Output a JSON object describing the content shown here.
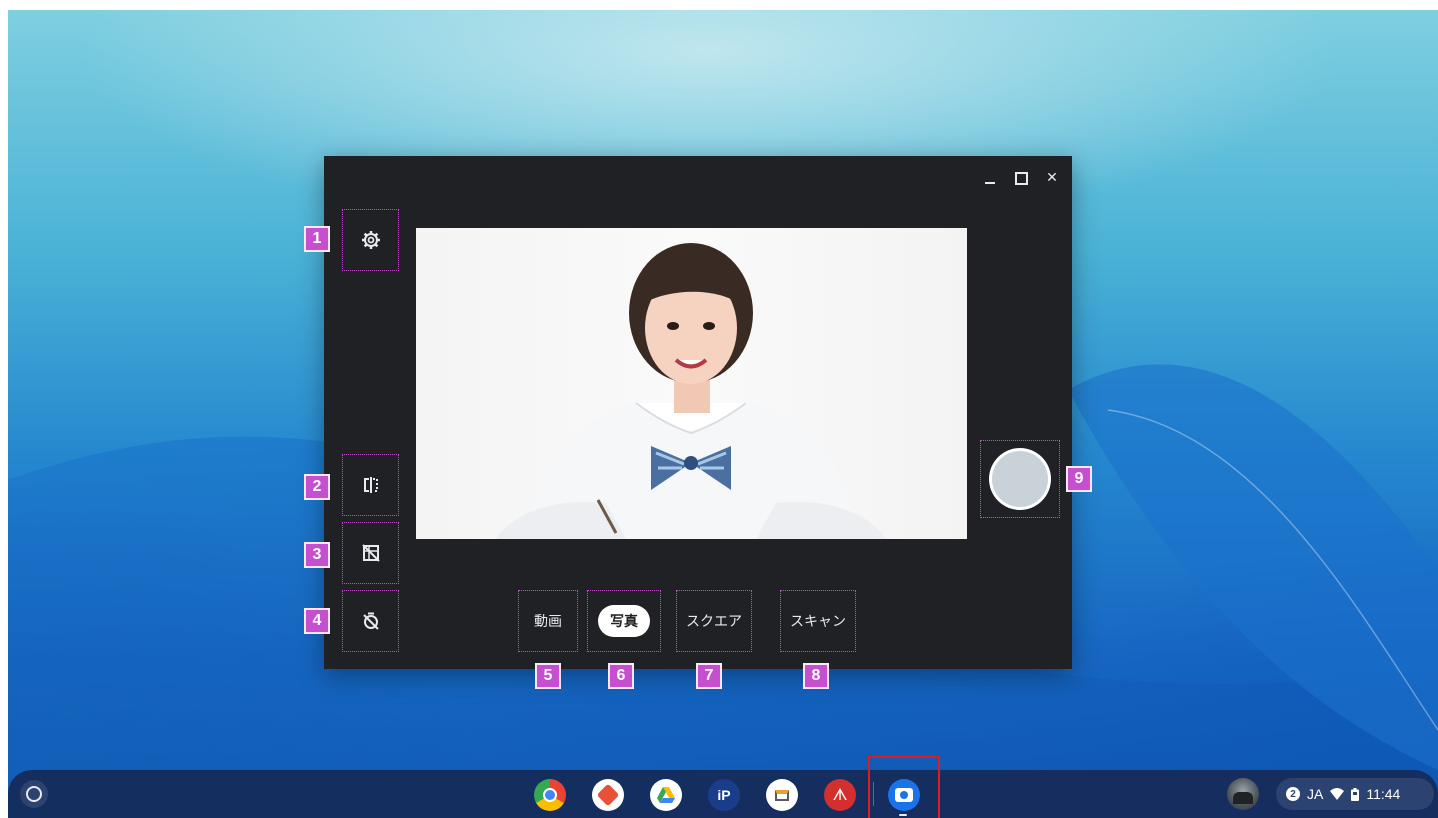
{
  "window": {
    "controls": {
      "minimize": "minimize-icon",
      "maximize": "maximize-icon",
      "close": "close-icon"
    }
  },
  "sidebar": {
    "settings": {
      "icon": "gear-icon",
      "number": "1"
    },
    "mirror": {
      "icon": "mirror-icon",
      "number": "2"
    },
    "grid": {
      "icon": "grid-off-icon",
      "number": "3"
    },
    "timer": {
      "icon": "timer-off-icon",
      "number": "4"
    }
  },
  "modes": [
    {
      "label": "動画",
      "number": "5"
    },
    {
      "label": "写真",
      "number": "6",
      "selected": true
    },
    {
      "label": "スクエア",
      "number": "7"
    },
    {
      "label": "スキャン",
      "number": "8"
    }
  ],
  "shutter": {
    "number": "9"
  },
  "shelf": {
    "apps": [
      "chrome-icon",
      "app-icon",
      "google-drive-icon",
      "picsart-icon",
      "app-icon",
      "acrobat-icon",
      "camera-app-icon"
    ],
    "tray": {
      "notification_count": "2",
      "ime": "JA",
      "time": "11:44"
    }
  },
  "colors": {
    "accent_marker": "#c64fd0",
    "highlight": "#e01b24",
    "window_bg": "#202124"
  }
}
